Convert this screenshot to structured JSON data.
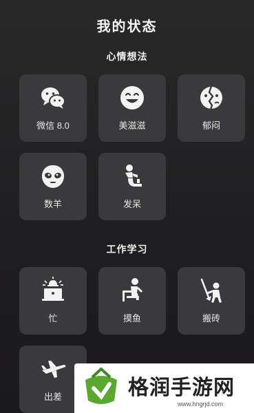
{
  "title": "我的状态",
  "sections": {
    "mood": {
      "title": "心情想法"
    },
    "work": {
      "title": "工作学习"
    }
  },
  "tiles": {
    "wechat": {
      "label": "微信 8.0",
      "icon": "wechat-icon"
    },
    "happy": {
      "label": "美滋滋",
      "icon": "smile-icon"
    },
    "depressed": {
      "label": "郁闷",
      "icon": "broken-face-icon"
    },
    "counting_sheep": {
      "label": "数羊",
      "icon": "sheep-face-icon"
    },
    "daze": {
      "label": "发呆",
      "icon": "sitting-person-icon"
    },
    "busy": {
      "label": "忙",
      "icon": "alarm-laptop-icon"
    },
    "slacking": {
      "label": "摸鱼",
      "icon": "person-at-desk-icon"
    },
    "toiling": {
      "label": "搬砖",
      "icon": "person-digging-icon"
    },
    "business_trip": {
      "label": "出差",
      "icon": "airplane-icon"
    }
  },
  "watermark": {
    "text": "格润手游网",
    "url": "www.hngrjd.com"
  },
  "colors": {
    "background": "#232224",
    "tile": "#3a3a3c",
    "icon": "#f2f2f2",
    "watermark_green": "#5aa92f"
  }
}
